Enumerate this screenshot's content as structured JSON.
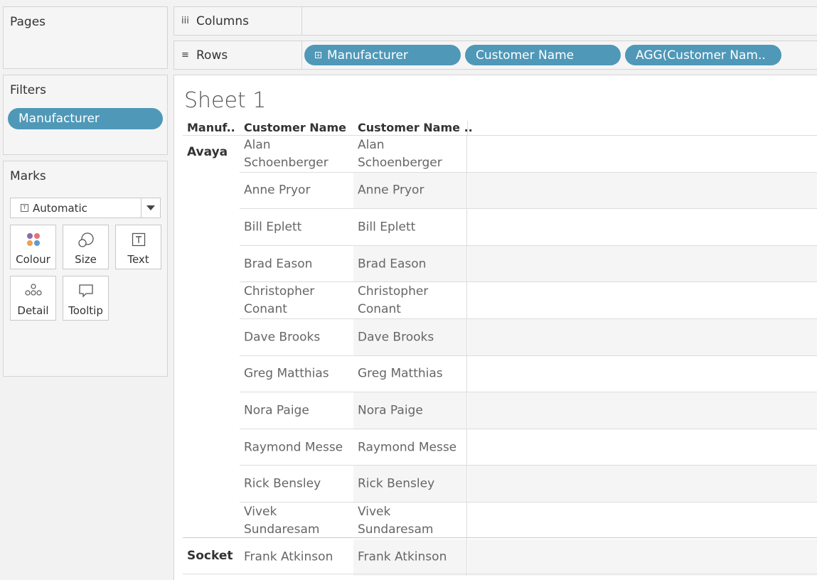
{
  "panels": {
    "pages": {
      "title": "Pages"
    },
    "filters": {
      "title": "Filters",
      "pill": "Manufacturer"
    },
    "marks": {
      "title": "Marks",
      "mark_type": "Automatic",
      "cards": {
        "colour": "Colour",
        "size": "Size",
        "text": "Text",
        "detail": "Detail",
        "tooltip": "Tooltip"
      }
    }
  },
  "shelves": {
    "columns": {
      "label": "Columns",
      "icon": "iii"
    },
    "rows": {
      "label": "Rows",
      "icon": "≡",
      "pills": [
        "Manufacturer",
        "Customer Name",
        "AGG(Customer Nam.."
      ]
    }
  },
  "sheet": {
    "title": "Sheet 1",
    "headers": [
      "Manuf..",
      "Customer Name",
      "Customer Name .."
    ],
    "groups": [
      {
        "name": "Avaya"
      },
      {
        "name": "Socket"
      }
    ],
    "rows": [
      {
        "c1": "Alan Schoenberger",
        "c2": "Alan Schoenberger"
      },
      {
        "c1": "Anne Pryor",
        "c2": "Anne Pryor"
      },
      {
        "c1": "Bill Eplett",
        "c2": "Bill Eplett"
      },
      {
        "c1": "Brad Eason",
        "c2": "Brad Eason"
      },
      {
        "c1": "Christopher Conant",
        "c2": "Christopher Conant"
      },
      {
        "c1": "Dave Brooks",
        "c2": "Dave Brooks"
      },
      {
        "c1": "Greg Matthias",
        "c2": "Greg Matthias"
      },
      {
        "c1": "Nora Paige",
        "c2": "Nora Paige"
      },
      {
        "c1": "Raymond Messe",
        "c2": "Raymond Messe"
      },
      {
        "c1": "Rick Bensley",
        "c2": "Rick Bensley"
      },
      {
        "c1": "Vivek Sundaresam",
        "c2": "Vivek Sundaresam"
      },
      {
        "c1": "Frank Atkinson",
        "c2": "Frank Atkinson"
      }
    ]
  },
  "colors": {
    "pill": "#4f98b8",
    "alt_row": "#f5f5f5"
  }
}
